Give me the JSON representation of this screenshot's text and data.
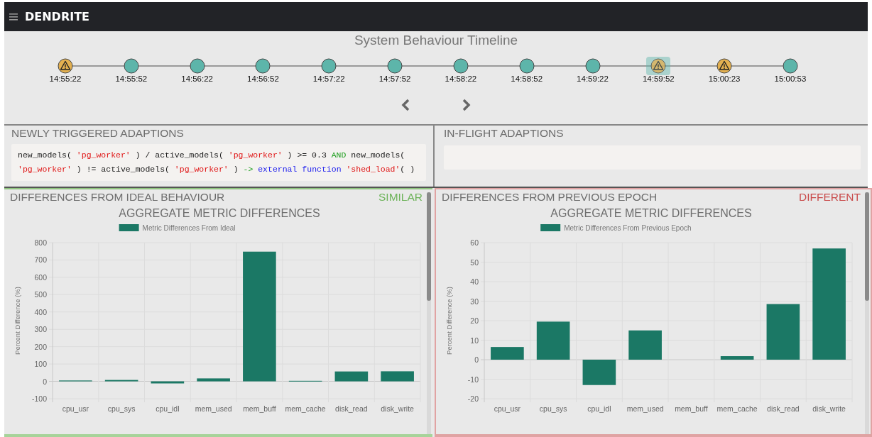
{
  "app": {
    "title": "DENDRITE"
  },
  "timeline": {
    "title": "System Behaviour Timeline",
    "nodes": [
      {
        "time": "14:55:22",
        "kind": "warning",
        "selected": false
      },
      {
        "time": "14:55:52",
        "kind": "normal",
        "selected": false
      },
      {
        "time": "14:56:22",
        "kind": "normal",
        "selected": false
      },
      {
        "time": "14:56:52",
        "kind": "normal",
        "selected": false
      },
      {
        "time": "14:57:22",
        "kind": "normal",
        "selected": false
      },
      {
        "time": "14:57:52",
        "kind": "normal",
        "selected": false
      },
      {
        "time": "14:58:22",
        "kind": "normal",
        "selected": false
      },
      {
        "time": "14:58:52",
        "kind": "normal",
        "selected": false
      },
      {
        "time": "14:59:22",
        "kind": "normal",
        "selected": false
      },
      {
        "time": "14:59:52",
        "kind": "warning",
        "selected": true
      },
      {
        "time": "15:00:23",
        "kind": "warning",
        "selected": false
      },
      {
        "time": "15:00:53",
        "kind": "normal",
        "selected": false
      }
    ]
  },
  "newly_triggered": {
    "title": "NEWLY TRIGGERED ADAPTIONS",
    "rules": [
      [
        {
          "text": "new_models( ",
          "kind": "plain"
        },
        {
          "text": "'pg_worker'",
          "kind": "string"
        },
        {
          "text": " ) / active_models( ",
          "kind": "plain"
        },
        {
          "text": "'pg_worker'",
          "kind": "string"
        },
        {
          "text": " ) >= 0.3 ",
          "kind": "plain"
        },
        {
          "text": "AND",
          "kind": "keyword"
        },
        {
          "text": " new_models( ",
          "kind": "plain"
        },
        {
          "text": "'pg_worker'",
          "kind": "string"
        },
        {
          "text": " ) != active_models( ",
          "kind": "plain"
        },
        {
          "text": "'pg_worker'",
          "kind": "string"
        },
        {
          "text": " ) ",
          "kind": "plain"
        },
        {
          "text": "->",
          "kind": "keyword"
        },
        {
          "text": " external function ",
          "kind": "function"
        },
        {
          "text": "'shed_load'",
          "kind": "string"
        },
        {
          "text": "( )",
          "kind": "plain"
        }
      ]
    ]
  },
  "in_flight": {
    "title": "IN-FLIGHT ADAPTIONS"
  },
  "panels": [
    {
      "title": "DIFFERENCES FROM IDEAL BEHAVIOUR",
      "verdict": "SIMILAR",
      "kind": "similar",
      "chart_data": {
        "type": "bar",
        "title": "AGGREGATE METRIC DIFFERENCES",
        "ylabel": "Percent Difference (%)",
        "categories": [
          "cpu_usr",
          "cpu_sys",
          "cpu_idl",
          "mem_used",
          "mem_buff",
          "mem_cache",
          "disk_read",
          "disk_write"
        ],
        "series": [
          {
            "name": "Metric Differences From Ideal",
            "color": "#1b7865",
            "values": [
              5,
              8,
              -12,
              17,
              748,
              3,
              57,
              58
            ]
          }
        ],
        "ylim": [
          -100,
          800
        ],
        "yticks": [
          -100,
          0,
          100,
          200,
          300,
          400,
          500,
          600,
          700,
          800
        ],
        "grid": true
      }
    },
    {
      "title": "DIFFERENCES FROM PREVIOUS EPOCH",
      "verdict": "DIFFERENT",
      "kind": "different",
      "chart_data": {
        "type": "bar",
        "title": "AGGREGATE METRIC DIFFERENCES",
        "ylabel": "Percent Difference (%)",
        "categories": [
          "cpu_usr",
          "cpu_sys",
          "cpu_idl",
          "mem_used",
          "mem_buff",
          "mem_cache",
          "disk_read",
          "disk_write"
        ],
        "series": [
          {
            "name": "Metric Differences From Previous Epoch",
            "color": "#1b7865",
            "values": [
              6.5,
              19.5,
              -13,
              15,
              0,
              1.8,
              28.5,
              57
            ]
          }
        ],
        "ylim": [
          -20,
          60
        ],
        "yticks": [
          -20,
          -10,
          0,
          10,
          20,
          30,
          40,
          50,
          60
        ],
        "grid": true
      }
    }
  ]
}
